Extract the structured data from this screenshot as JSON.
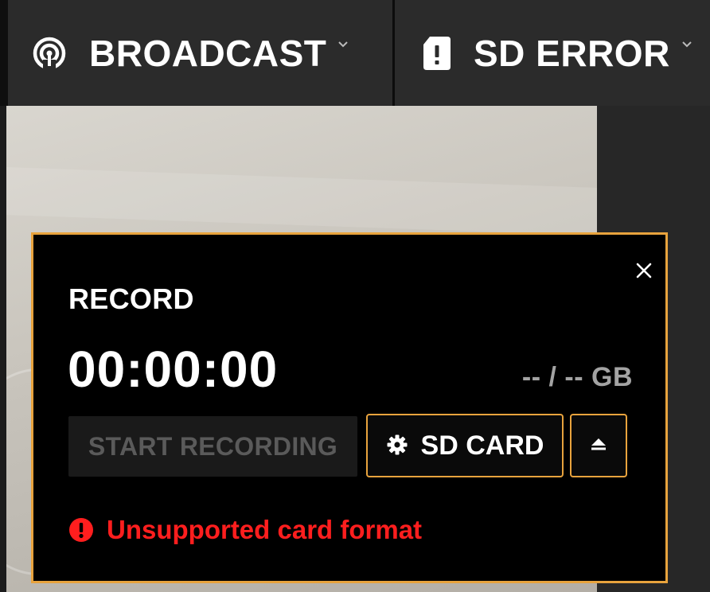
{
  "toolbar": {
    "broadcast": {
      "label": "BROADCAST",
      "icon": "broadcast-icon"
    },
    "sd_status": {
      "label": "SD ERROR",
      "icon": "sd-card-error-icon"
    }
  },
  "record_panel": {
    "title": "RECORD",
    "timer": "00:00:00",
    "storage": "-- / -- GB",
    "start_button": "START RECORDING",
    "sd_button": "SD CARD",
    "error_message": "Unsupported card format"
  },
  "colors": {
    "accent": "#e8a33d",
    "error": "#ff1e1e",
    "panel_bg": "#000000",
    "toolbar_bg": "#2b2b2b"
  }
}
